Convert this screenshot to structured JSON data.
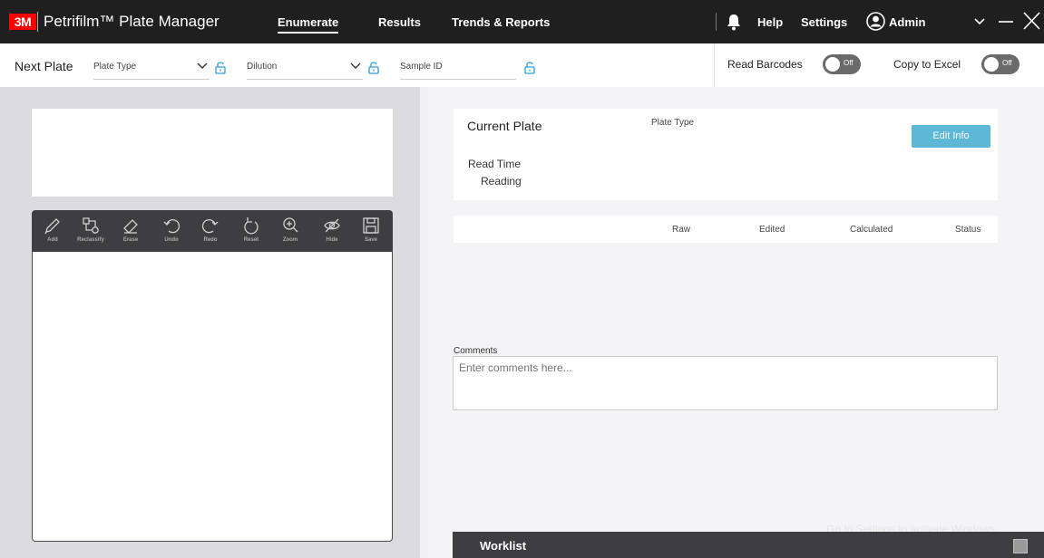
{
  "titlebar": {
    "logo_text": "3M",
    "app_title": "Petrifilm™ Plate Manager",
    "nav": {
      "enumerate": "Enumerate",
      "results": "Results",
      "trends": "Trends & Reports"
    },
    "help": "Help",
    "settings": "Settings",
    "user": "Admin",
    "icons": [
      "bell-icon",
      "user-avatar-icon",
      "chevron-down-icon",
      "minimize-icon",
      "close-icon"
    ]
  },
  "next_plate": {
    "label": "Next Plate",
    "plate_type_placeholder": "Plate Type",
    "dilution_placeholder": "Dilution",
    "sample_id_placeholder": "Sample ID",
    "read_barcodes_label": "Read Barcodes",
    "read_barcodes_state": "Off",
    "copy_excel_label": "Copy to Excel",
    "copy_excel_state": "Off"
  },
  "tools": [
    {
      "label": "Add",
      "icon": "pencil-icon"
    },
    {
      "label": "Reclassify",
      "icon": "reclassify-icon"
    },
    {
      "label": "Erase",
      "icon": "eraser-icon"
    },
    {
      "label": "Undo",
      "icon": "undo-icon"
    },
    {
      "label": "Redo",
      "icon": "redo-icon"
    },
    {
      "label": "Reset",
      "icon": "reset-icon"
    },
    {
      "label": "Zoom",
      "icon": "zoom-icon"
    },
    {
      "label": "Hide",
      "icon": "hide-icon"
    },
    {
      "label": "Save",
      "icon": "save-icon"
    }
  ],
  "current_plate": {
    "title": "Current Plate",
    "plate_type_label": "Plate Type",
    "edit_button": "Edit Info",
    "read_time_label": "Read Time",
    "reading_label": "Reading"
  },
  "results_table": {
    "columns": [
      "Raw",
      "Edited",
      "Calculated",
      "Status"
    ]
  },
  "comments": {
    "label": "Comments",
    "placeholder": "Enter comments here..."
  },
  "worklist": {
    "label": "Worklist"
  },
  "watermark": "Go to Settings to activate Windows.",
  "colors": {
    "titlebar_bg": "#1f1f1f",
    "logo_red": "#ff0000",
    "accent_button": "#5cb8d6",
    "lock_blue": "#2a9fd6",
    "toolbar_bg": "#3e3e42",
    "toggle_off": "#6a6a6a"
  }
}
